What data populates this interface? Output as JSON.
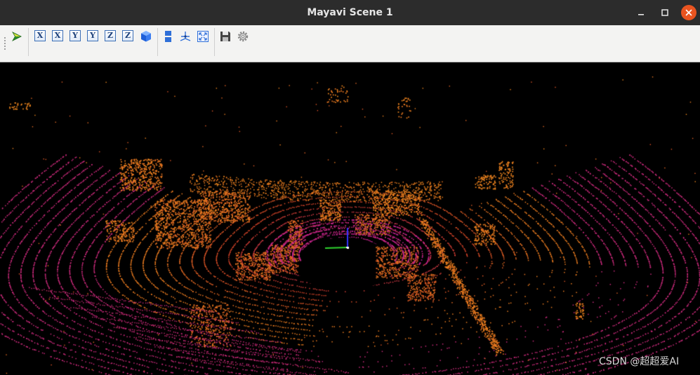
{
  "window": {
    "title": "Mayavi Scene 1"
  },
  "toolbar": {
    "buttons": [
      {
        "name": "mayavi-pipeline-button",
        "icon": "mayavi-logo-icon"
      },
      {
        "name": "view-x-positive-button",
        "label": "X"
      },
      {
        "name": "view-x-negative-button",
        "label": "X"
      },
      {
        "name": "view-y-positive-button",
        "label": "Y"
      },
      {
        "name": "view-y-negative-button",
        "label": "Y"
      },
      {
        "name": "view-z-positive-button",
        "label": "Z"
      },
      {
        "name": "view-z-negative-button",
        "label": "Z"
      },
      {
        "name": "isometric-view-button",
        "icon": "cube-icon"
      },
      {
        "name": "parallel-projection-button",
        "icon": "parallel-projection-icon"
      },
      {
        "name": "toggle-axes-button",
        "icon": "axes-icon"
      },
      {
        "name": "full-screen-button",
        "icon": "fullscreen-icon"
      },
      {
        "name": "save-scene-button",
        "icon": "save-icon"
      },
      {
        "name": "configure-scene-button",
        "icon": "gear-icon"
      }
    ]
  },
  "colors": {
    "titlebar": "#2c2c2c",
    "close_button": "#e95420",
    "toolbar": "#f3f3f2",
    "scene_background": "#000000",
    "point_near": "#c41f9e",
    "point_mid": "#d9432a",
    "point_far": "#f08a1e",
    "axis_x": "#ffffff",
    "axis_y": "#2fd62f",
    "axis_z": "#3333ff"
  },
  "scene": {
    "description_icon": "lidar-point-cloud",
    "watermark": "CSDN @超超爱AI"
  }
}
